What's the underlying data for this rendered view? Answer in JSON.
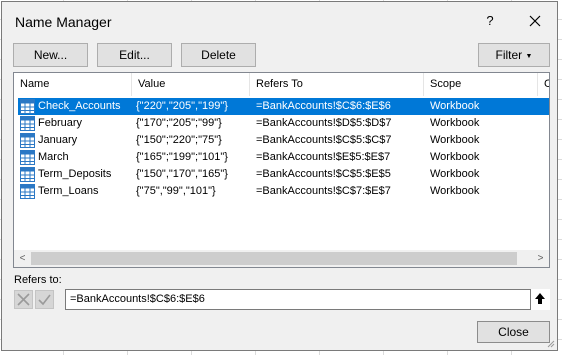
{
  "dialog": {
    "title": "Name Manager",
    "help_label": "?",
    "close_icon": "close-icon"
  },
  "toolbar": {
    "new_label": "New...",
    "edit_label": "Edit...",
    "delete_label": "Delete",
    "filter_label": "Filter"
  },
  "list": {
    "columns": [
      "Name",
      "Value",
      "Refers To",
      "Scope",
      "C"
    ],
    "rows": [
      {
        "name": "Check_Accounts",
        "value": "{\"220\",\"205\",\"199\"}",
        "refers_to": "=BankAccounts!$C$6:$E$6",
        "scope": "Workbook",
        "selected": true
      },
      {
        "name": "February",
        "value": "{\"170\";\"205\";\"99\"}",
        "refers_to": "=BankAccounts!$D$5:$D$7",
        "scope": "Workbook",
        "selected": false
      },
      {
        "name": "January",
        "value": "{\"150\";\"220\";\"75\"}",
        "refers_to": "=BankAccounts!$C$5:$C$7",
        "scope": "Workbook",
        "selected": false
      },
      {
        "name": "March",
        "value": "{\"165\";\"199\";\"101\"}",
        "refers_to": "=BankAccounts!$E$5:$E$7",
        "scope": "Workbook",
        "selected": false
      },
      {
        "name": "Term_Deposits",
        "value": "{\"150\",\"170\",\"165\"}",
        "refers_to": "=BankAccounts!$C$5:$E$5",
        "scope": "Workbook",
        "selected": false
      },
      {
        "name": "Term_Loans",
        "value": "{\"75\",\"99\",\"101\"}",
        "refers_to": "=BankAccounts!$C$7:$E$7",
        "scope": "Workbook",
        "selected": false
      }
    ]
  },
  "refers": {
    "label": "Refers to:",
    "value": "=BankAccounts!$C$6:$E$6"
  },
  "footer": {
    "close_label": "Close"
  },
  "colors": {
    "selection": "#0078d7",
    "dialog_bg": "#f0f0f0",
    "icon_blue": "#2b78c5"
  }
}
